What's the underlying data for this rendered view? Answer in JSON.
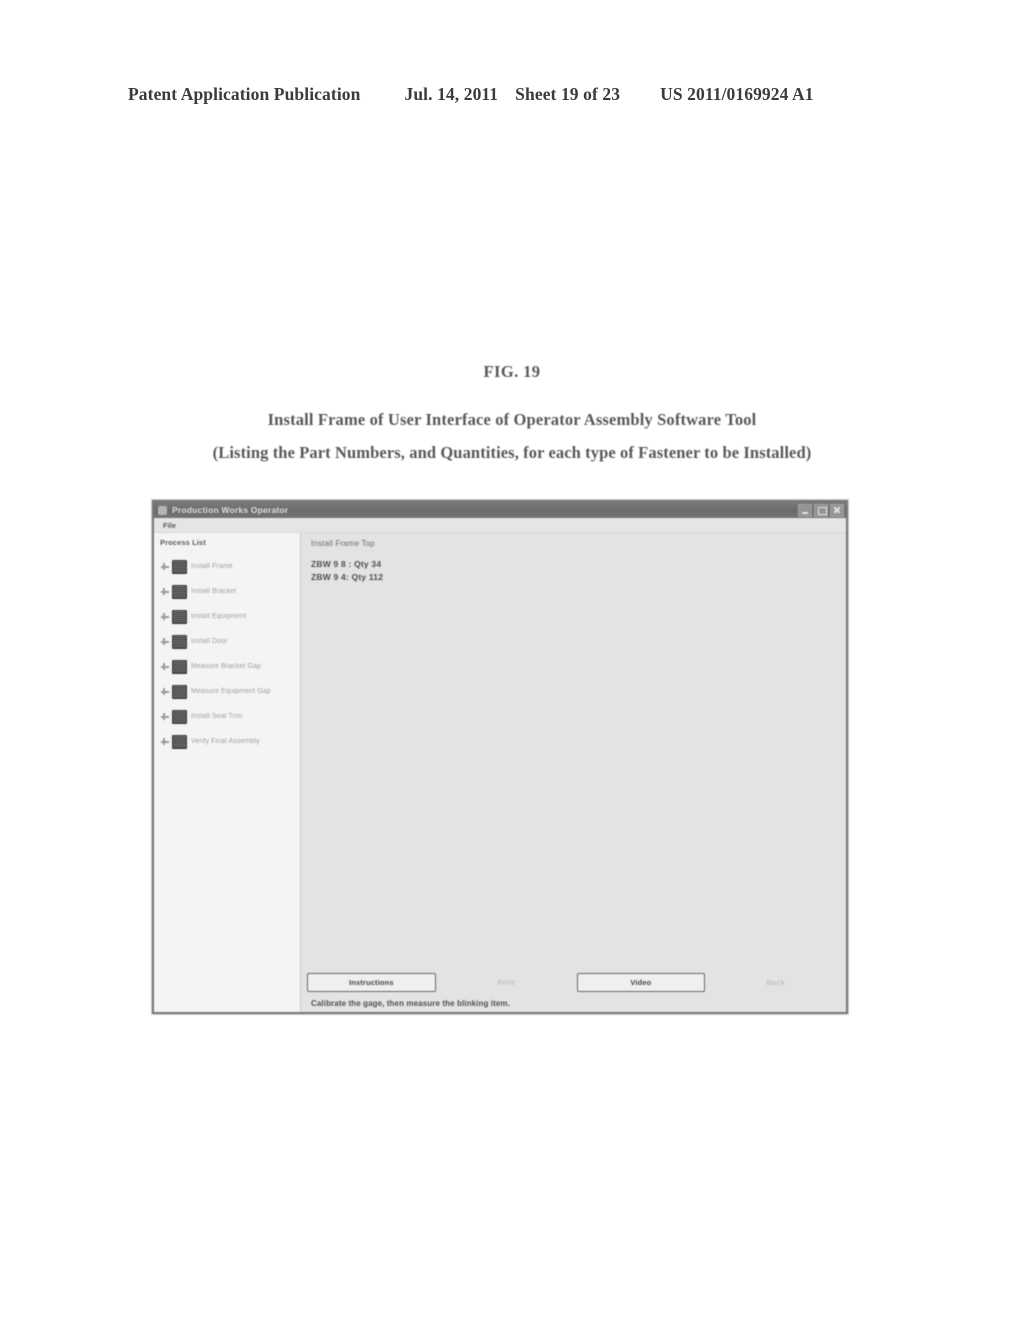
{
  "patent_header": {
    "publication": "Patent Application Publication",
    "date": "Jul. 14, 2011",
    "sheet": "Sheet 19 of 23",
    "number": "US 2011/0169924 A1"
  },
  "figure": {
    "label": "FIG. 19",
    "title": "Install Frame of User Interface of Operator Assembly Software Tool",
    "subtitle": "(Listing the Part Numbers, and Quantities, for each type of Fastener to be Installed)"
  },
  "app": {
    "title": "Production Works Operator",
    "window_controls": [
      {
        "name": "minimize",
        "glyph": "minimize-icon"
      },
      {
        "name": "maximize",
        "glyph": "maximize-icon"
      },
      {
        "name": "close",
        "glyph": "close-icon"
      }
    ],
    "menu": [
      {
        "label": "File"
      }
    ],
    "tree": {
      "header": "Process List",
      "items": [
        {
          "label": "Install Frame"
        },
        {
          "label": "Install Bracket"
        },
        {
          "label": "Install Equipment"
        },
        {
          "label": "Install Door"
        },
        {
          "label": "Measure Bracket Gap"
        },
        {
          "label": "Measure Equipment Gap"
        },
        {
          "label": "Install Seal Trim"
        },
        {
          "label": "Verify Final Assembly"
        }
      ]
    },
    "content": {
      "heading": "Install Frame Top",
      "parts": [
        {
          "line": "ZBW 9 8 : Qty 34"
        },
        {
          "line": "ZBW 9 4: Qty 112"
        }
      ]
    },
    "buttons": [
      {
        "label": "Instructions",
        "state": "enabled"
      },
      {
        "label": "Print",
        "state": "disabled"
      },
      {
        "label": "Video",
        "state": "enabled"
      },
      {
        "label": "Back",
        "state": "disabled"
      }
    ],
    "status": "Calibrate the gage, then measure the blinking item."
  }
}
